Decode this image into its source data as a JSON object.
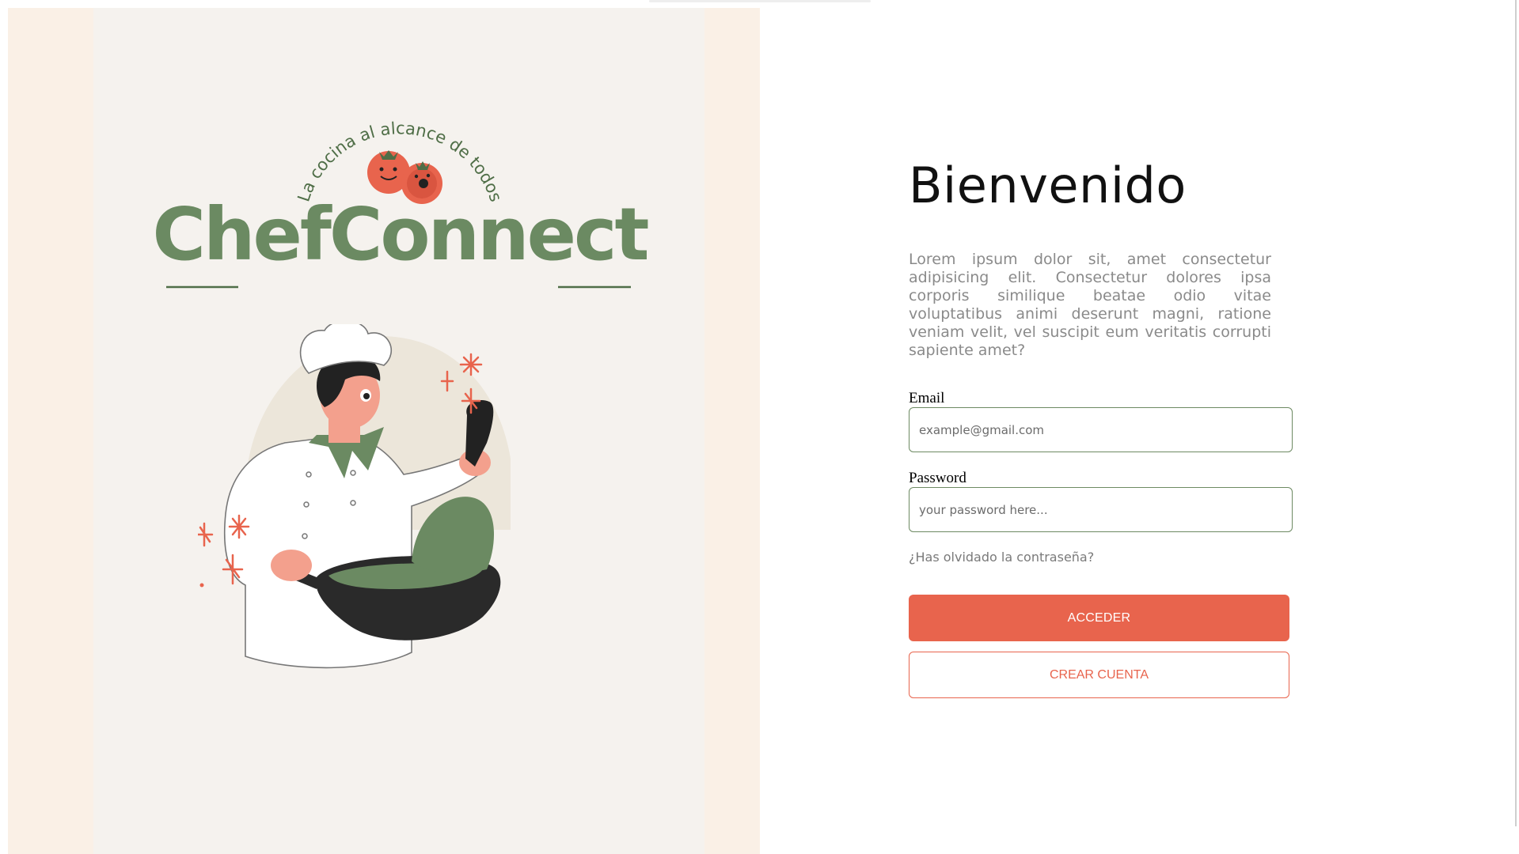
{
  "brand": {
    "name": "ChefConnect",
    "tagline": "La cocina al alcance de todos",
    "colors": {
      "green": "#6b8a62",
      "tomato": "#e8644d",
      "panel": "#f5f2ee",
      "panel_edge": "#faf0e6"
    }
  },
  "login": {
    "title": "Bienvenido",
    "intro": "Lorem ipsum dolor sit, amet consectetur adipisicing elit. Consectetur dolores ipsa corporis similique beatae odio vitae voluptatibus animi deserunt magni, ratione veniam velit, vel suscipit eum veritatis corrupti sapiente amet?",
    "email": {
      "label": "Email",
      "placeholder": "example@gmail.com",
      "value": ""
    },
    "password": {
      "label": "Password",
      "placeholder": "your password here...",
      "value": ""
    },
    "forgot_label": "¿Has olvidado la contraseña?",
    "submit_label": "ACCEDER",
    "create_label": "CREAR CUENTA"
  }
}
